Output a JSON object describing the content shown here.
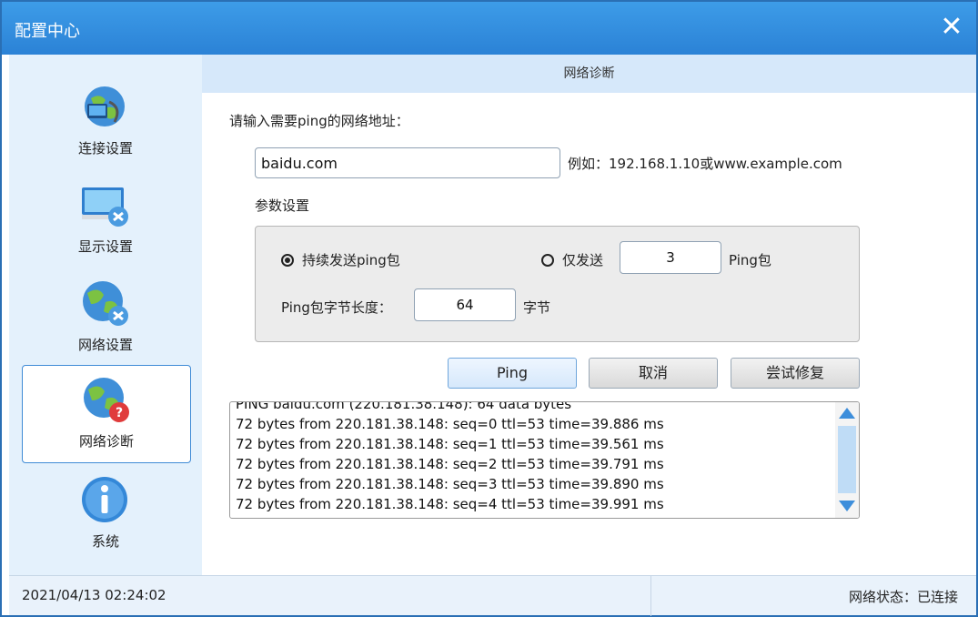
{
  "window": {
    "title": "配置中心",
    "close_icon": "close-icon"
  },
  "sidebar": {
    "items": [
      {
        "label": "连接设置",
        "icon": "connection-globe-icon",
        "active": false
      },
      {
        "label": "显示设置",
        "icon": "monitor-settings-icon",
        "active": false
      },
      {
        "label": "网络设置",
        "icon": "globe-settings-icon",
        "active": false
      },
      {
        "label": "网络诊断",
        "icon": "globe-help-icon",
        "active": true
      },
      {
        "label": "系统",
        "icon": "info-icon",
        "active": false
      }
    ]
  },
  "header": {
    "title": "网络诊断"
  },
  "form": {
    "prompt": "请输入需要ping的网络地址：",
    "address_value": "baidu.com",
    "example": "例如：192.168.1.10或www.example.com",
    "params_title": "参数设置",
    "continuous_label": "持续发送ping包",
    "continuous_selected": true,
    "only_send_label": "仅发送",
    "only_send_count": "3",
    "only_send_unit": "Ping包",
    "size_label": "Ping包字节长度：",
    "size_value": "64",
    "size_unit": "字节"
  },
  "buttons": {
    "ping": "Ping",
    "cancel": "取消",
    "repair": "尝试修复"
  },
  "log": {
    "lines": [
      "PING baidu.com (220.181.38.148): 64 data bytes",
      "72 bytes from 220.181.38.148: seq=0 ttl=53 time=39.886 ms",
      "72 bytes from 220.181.38.148: seq=1 ttl=53 time=39.561 ms",
      "72 bytes from 220.181.38.148: seq=2 ttl=53 time=39.791 ms",
      "72 bytes from 220.181.38.148: seq=3 ttl=53 time=39.890 ms",
      "72 bytes from 220.181.38.148: seq=4 ttl=53 time=39.991 ms"
    ]
  },
  "status": {
    "datetime": "2021/04/13 02:24:02",
    "network": "网络状态：已连接"
  },
  "colors": {
    "accent": "#2b82d6",
    "sidebar_bg": "#e4f1fc",
    "header_bg": "#d6e8fa"
  }
}
